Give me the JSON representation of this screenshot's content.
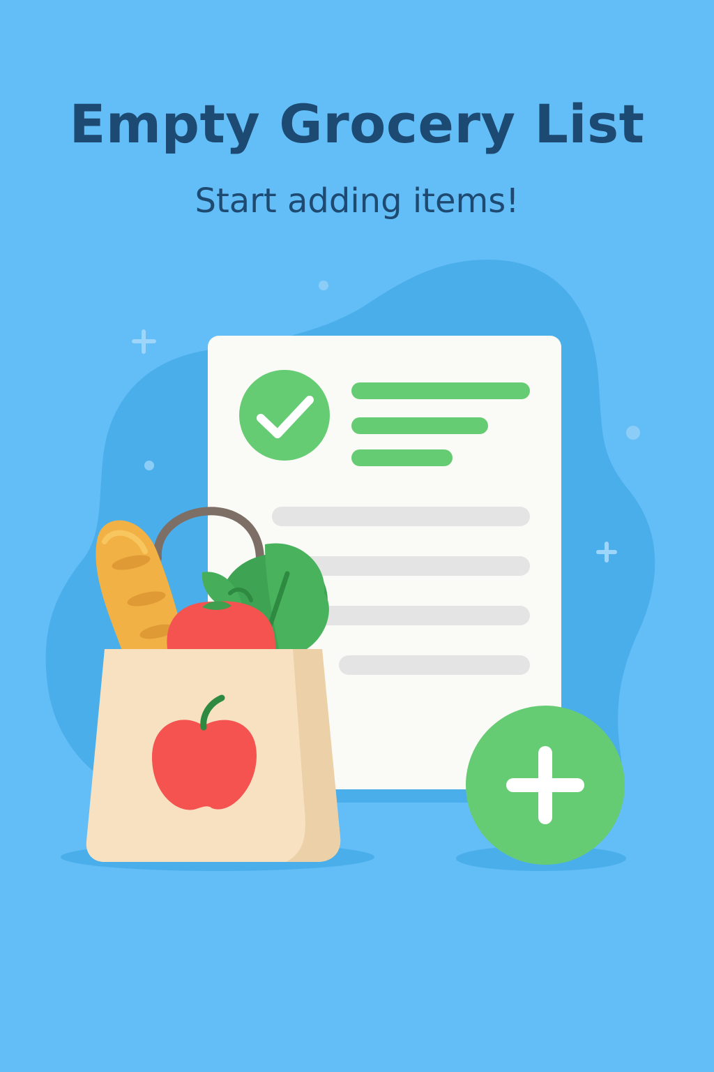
{
  "screen": {
    "title": "Empty Grocery List",
    "subtitle": "Start adding items!"
  },
  "add_button": {
    "icon": "plus-icon"
  },
  "illustration": {
    "list_document_icon": "checklist-document-icon",
    "check_icon": "checkmark-circle-icon",
    "bag_icon": "grocery-bag-icon",
    "items": [
      "baguette-icon",
      "tomato-icon",
      "leafy-greens-icon",
      "apple-icon"
    ]
  },
  "colors": {
    "background": "#63bdf6",
    "blob": "#4aaeea",
    "title": "#1d4a73",
    "accent_green": "#66cc73",
    "paper": "#fafaf6",
    "placeholder_line": "#e4e4e4"
  }
}
